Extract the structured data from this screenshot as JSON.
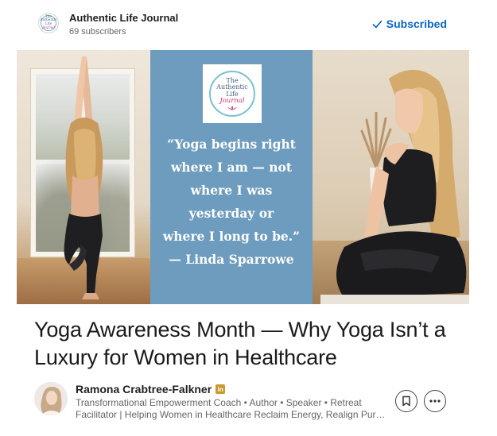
{
  "publication": {
    "name": "Authentic Life Journal",
    "subscribers": "69 subscribers",
    "logo_lines": [
      "The",
      "Authentic",
      "Life",
      "Journal"
    ],
    "subscribe_label": "Subscribed"
  },
  "banner": {
    "quote_lines": [
      "“Yoga begins right",
      "where I am — not",
      "where I was",
      "yesterday or",
      "where I long to be.”",
      "— Linda Sparrowe"
    ]
  },
  "article": {
    "title": "Yoga Awareness Month — Why Yoga Isn’t a Luxury for Women in Healthcare"
  },
  "author": {
    "name": "Ramona Crabtree-Falkner",
    "badge": "in",
    "bio_line1": "Transformational Empowerment Coach • Author • Speaker • Retreat",
    "bio_line2": "Facilitator | Helping Women in Healthcare Reclaim Energy, Realign Purpose & Lead with Heart"
  },
  "colors": {
    "accent": "#0a66c2",
    "banner_mid": "#6e9cbe",
    "badge": "#c99a2e"
  },
  "icons": {
    "subscribe": "check-icon",
    "save": "bookmark-icon",
    "more": "more-horizontal-icon",
    "verified": "linkedin-icon"
  }
}
